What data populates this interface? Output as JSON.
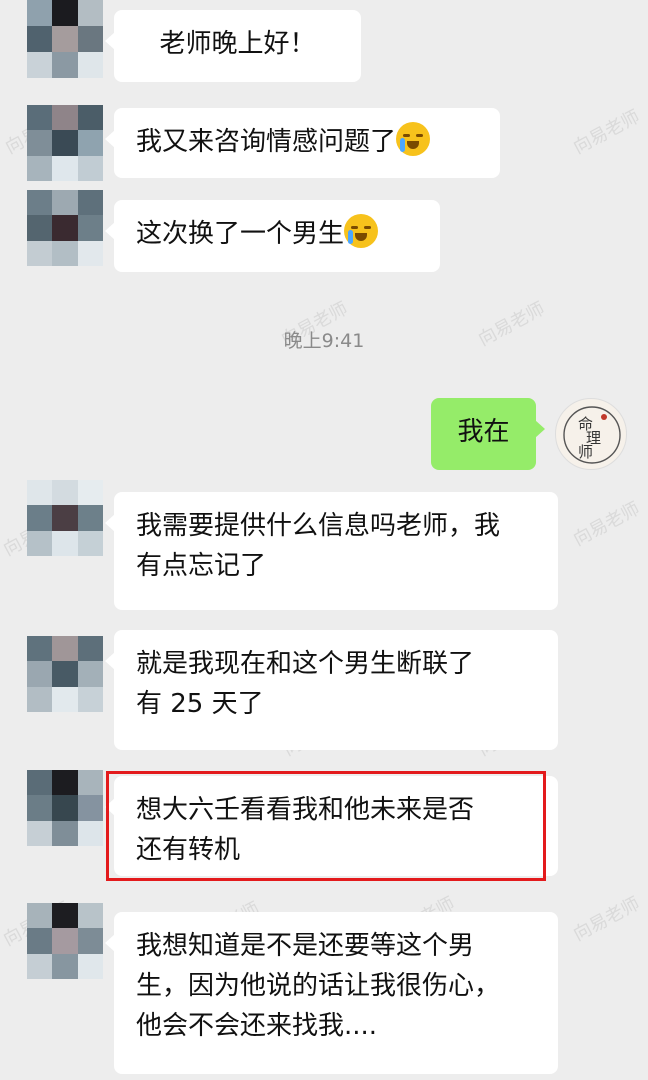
{
  "watermark": "向易老师",
  "timestamp": "晚上9:41",
  "messages": [
    {
      "side": "left",
      "text": "老师晚上好！",
      "emoji": false
    },
    {
      "side": "left",
      "text": "我又来咨询情感问题了",
      "emoji": true
    },
    {
      "side": "left",
      "text": "这次换了一个男生",
      "emoji": true
    },
    {
      "side": "right",
      "text": "我在",
      "emoji": false
    },
    {
      "side": "left",
      "lines": [
        "我需要提供什么信息吗老师，我",
        "有点忘记了"
      ]
    },
    {
      "side": "left",
      "lines": [
        "就是我现在和这个男生断联了",
        "有 25 天了"
      ]
    },
    {
      "side": "left",
      "lines": [
        "想大六壬看看我和他未来是否",
        "还有转机"
      ],
      "highlighted": true
    },
    {
      "side": "left",
      "lines": [
        "我想知道是不是还要等这个男",
        "生，因为他说的话让我很伤心，",
        "他会不会还来找我...."
      ]
    }
  ],
  "right_avatar": {
    "text": "命理师",
    "icon": "fortune-teller-logo-icon"
  },
  "colors": {
    "background": "#ededed",
    "bubble_left": "#ffffff",
    "bubble_right": "#95ec69",
    "highlight": "#e31a1c"
  }
}
